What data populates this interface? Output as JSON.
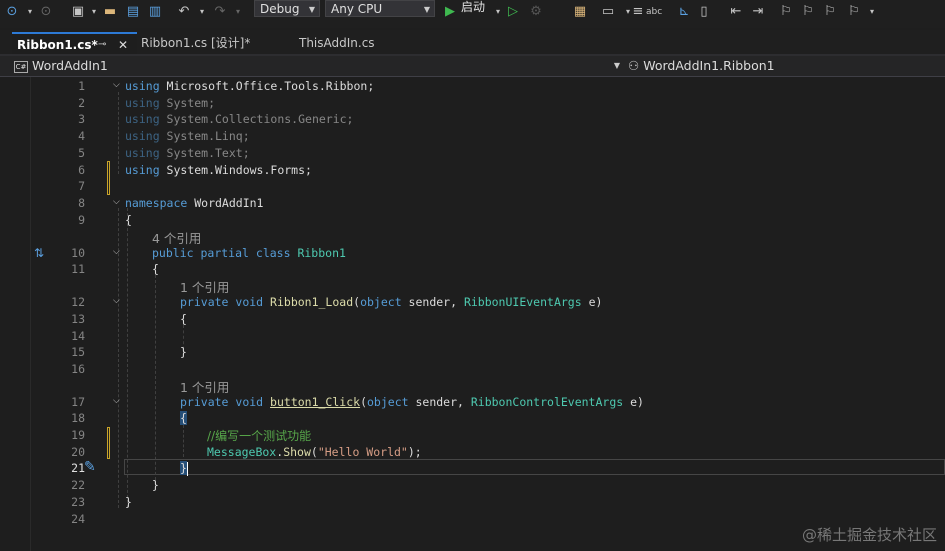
{
  "toolbar": {
    "config": "Debug",
    "platform": "Any CPU",
    "start_label": "启动"
  },
  "tabs": [
    {
      "label": "Ribbon1.cs*"
    },
    {
      "label": "Ribbon1.cs [设计]*"
    },
    {
      "label": "ThisAddIn.cs"
    }
  ],
  "nav": {
    "project": "WordAddIn1",
    "type_member": "WordAddIn1.Ribbon1"
  },
  "editor": {
    "line_numbers": [
      "1",
      "2",
      "3",
      "4",
      "5",
      "6",
      "7",
      "8",
      "9",
      "10",
      "11",
      "12",
      "13",
      "14",
      "15",
      "16",
      "17",
      "18",
      "19",
      "20",
      "21",
      "22",
      "23",
      "24"
    ],
    "code": {
      "l1": "using",
      "l1b": " Microsoft.Office.Tools.Ribbon;",
      "l2": "using",
      "l2b": " System;",
      "l3": "using",
      "l3b": " System.Collections.Generic;",
      "l4": "using",
      "l4b": " System.Linq;",
      "l5": "using",
      "l5b": " System.Text;",
      "l6": "using",
      "l6b": " System.Windows.Forms;",
      "l8": "namespace",
      "l8b": " WordAddIn1",
      "l9": "{",
      "ref10": "4 个引用",
      "l10a": "public",
      "l10b": " ",
      "l10c": "partial",
      "l10d": " ",
      "l10e": "class",
      "l10f": " ",
      "l10g": "Ribbon1",
      "l11": "{",
      "ref12": "1 个引用",
      "l12a": "private",
      "l12b": " ",
      "l12c": "void",
      "l12d": " ",
      "l12e": "Ribbon1_Load",
      "l12f": "(",
      "l12g": "object",
      "l12h": " sender, ",
      "l12i": "RibbonUIEventArgs",
      "l12j": " e)",
      "l13": "{",
      "l15": "}",
      "ref17": "1 个引用",
      "l17a": "private",
      "l17b": " ",
      "l17c": "void",
      "l17d": " ",
      "l17e": "button1_Click",
      "l17f": "(",
      "l17g": "object",
      "l17h": " sender, ",
      "l17i": "RibbonControlEventArgs",
      "l17j": " e)",
      "l18": "{",
      "l19": "//编写一个测试功能",
      "l20a": "MessageBox",
      "l20b": ".",
      "l20c": "Show",
      "l20d": "(",
      "l20e": "\"Hello World\"",
      "l20f": ");",
      "l21": "}",
      "l22": "}",
      "l23": "}"
    }
  },
  "watermark": "@稀土掘金技术社区"
}
